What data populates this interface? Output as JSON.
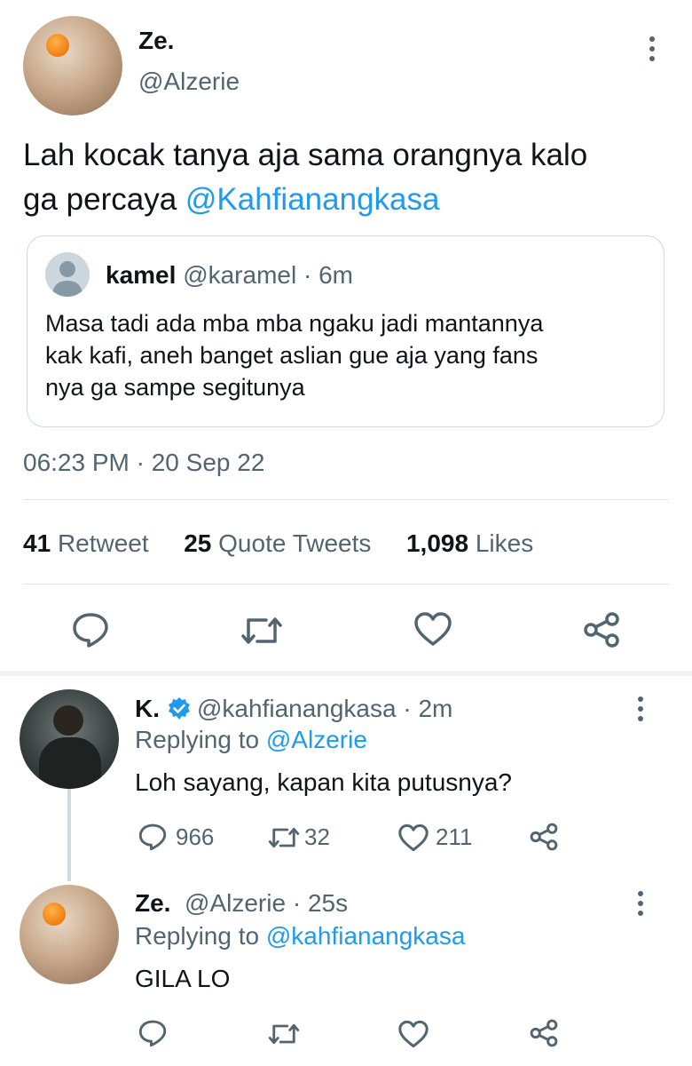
{
  "main_tweet": {
    "display_name": "Ze.",
    "handle": "@Alzerie",
    "text_line1": "Lah kocak tanya aja sama orangnya kalo",
    "text_line2_prefix": "ga percaya ",
    "mention": "@Kahfianangkasa",
    "quoted": {
      "display_name": "kamel",
      "handle": "@karamel",
      "time": "6m",
      "line1": "Masa tadi ada mba mba ngaku jadi mantannya",
      "line2": "kak kafi, aneh banget aslian gue aja yang fans",
      "line3": "nya ga sampe segitunya"
    },
    "timestamp": "06:23 PM · 20 Sep 22",
    "stats": {
      "retweets_count": "41",
      "retweets_label": "Retweet",
      "quotes_count": "25",
      "quotes_label": "Quote Tweets",
      "likes_count": "1,098",
      "likes_label": "Likes"
    }
  },
  "replies": [
    {
      "display_name": "K.",
      "verified": true,
      "handle": "@kahfianangkasa",
      "time": "2m",
      "replying_prefix": "Replying to ",
      "replying_to": "@Alzerie",
      "text": "Loh sayang, kapan kita putusnya?",
      "reply_count": "966",
      "retweet_count": "32",
      "like_count": "211"
    },
    {
      "display_name": "Ze.",
      "handle": "@Alzerie",
      "time": "25s",
      "replying_prefix": "Replying to ",
      "replying_to": "@kahfianangkasa",
      "text": "GILA LO"
    }
  ],
  "colors": {
    "accent": "#1d9bf0",
    "muted": "#536471",
    "divider": "#e1e8ed"
  },
  "icons": [
    "more-icon",
    "reply-icon",
    "retweet-icon",
    "like-icon",
    "share-icon",
    "verified-badge-icon"
  ]
}
